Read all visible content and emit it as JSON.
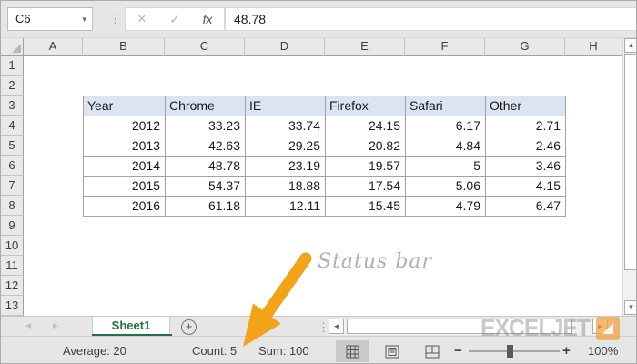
{
  "formula_bar": {
    "name_box_value": "C6",
    "formula_value": "48.78"
  },
  "icons": {
    "name_box_dropdown": "▾",
    "cancel": "✕",
    "enter": "✓",
    "insert_function": "fx",
    "vertical_dots": "⋮",
    "scroll_up": "▲",
    "scroll_down": "▼",
    "scroll_left": "◄",
    "scroll_right": "►",
    "tab_nav_left": "◄",
    "tab_nav_right": "►",
    "add_sheet": "+",
    "zoom_out": "−",
    "zoom_in": "+"
  },
  "grid": {
    "columns": [
      "A",
      "B",
      "C",
      "D",
      "E",
      "F",
      "G",
      "H"
    ],
    "rows": [
      "1",
      "2",
      "3",
      "4",
      "5",
      "6",
      "7",
      "8",
      "9",
      "10",
      "11",
      "12",
      "13"
    ],
    "table": {
      "start_cell": "B3",
      "headers": [
        "Year",
        "Chrome",
        "IE",
        "Firefox",
        "Safari",
        "Other"
      ],
      "data": [
        [
          "2012",
          "33.23",
          "33.74",
          "24.15",
          "6.17",
          "2.71"
        ],
        [
          "2013",
          "42.63",
          "29.25",
          "20.82",
          "4.84",
          "2.46"
        ],
        [
          "2014",
          "48.78",
          "23.19",
          "19.57",
          "5",
          "3.46"
        ],
        [
          "2015",
          "54.37",
          "18.88",
          "17.54",
          "5.06",
          "4.15"
        ],
        [
          "2016",
          "61.18",
          "12.11",
          "15.45",
          "4.79",
          "6.47"
        ]
      ]
    }
  },
  "sheet_bar": {
    "active_tab": "Sheet1"
  },
  "status_bar": {
    "average": "Average: 20",
    "count": "Count: 5",
    "sum": "Sum: 100",
    "zoom_level": "100%"
  },
  "annotation": {
    "text": "Status bar"
  },
  "watermark": {
    "text": "EXCELJET"
  },
  "colors": {
    "accent_green": "#217346",
    "annotation_orange": "#F2A317",
    "logo_orange": "#F2A13C",
    "table_header_fill": "#DCE3F1",
    "chrome_gray": "#E6E6E6"
  }
}
